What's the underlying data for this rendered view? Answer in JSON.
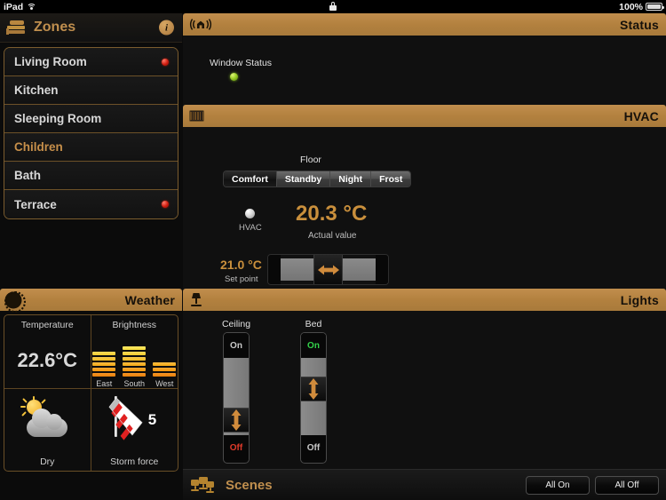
{
  "statusbar": {
    "device": "iPad",
    "wifi_icon": "wifi-icon",
    "lock_icon": "lock-icon",
    "battery_percent": "100%",
    "battery_icon": "battery-icon"
  },
  "sidebar": {
    "header": {
      "title": "Zones",
      "icon": "bed-icon",
      "info_label": "i"
    },
    "zones": [
      {
        "label": "Living Room",
        "selected": false,
        "alarm": true
      },
      {
        "label": "Kitchen",
        "selected": false,
        "alarm": false
      },
      {
        "label": "Sleeping Room",
        "selected": false,
        "alarm": false
      },
      {
        "label": "Children",
        "selected": true,
        "alarm": false
      },
      {
        "label": "Bath",
        "selected": false,
        "alarm": false
      },
      {
        "label": "Terrace",
        "selected": false,
        "alarm": true
      }
    ]
  },
  "weather": {
    "header": {
      "title": "Weather",
      "icon": "sun-icon"
    },
    "temperature": {
      "label": "Temperature",
      "value": "22.6°C"
    },
    "brightness": {
      "label": "Brightness",
      "directions": [
        {
          "name": "East",
          "level": 5
        },
        {
          "name": "South",
          "level": 6
        },
        {
          "name": "West",
          "level": 3
        }
      ],
      "max_level": 6
    },
    "condition": {
      "icon": "sun-cloud-icon",
      "label": "Dry"
    },
    "wind": {
      "icon": "windsock-icon",
      "value": "5",
      "label": "Storm force"
    }
  },
  "status_panel": {
    "header": {
      "title": "Status",
      "icon": "house-signal-icon"
    },
    "items": [
      {
        "label": "Window Status",
        "led": "green"
      }
    ]
  },
  "hvac": {
    "header": {
      "title": "HVAC",
      "icon": "radiator-icon"
    },
    "zone_label": "Floor",
    "modes": [
      {
        "label": "Comfort",
        "active": true
      },
      {
        "label": "Standby",
        "active": false
      },
      {
        "label": "Night",
        "active": false
      },
      {
        "label": "Frost",
        "active": false
      }
    ],
    "indicator": {
      "label": "HVAC",
      "state": "white"
    },
    "actual": {
      "value": "20.3 °C",
      "label": "Actual value"
    },
    "setpoint": {
      "value": "21.0 °C",
      "label": "Set point",
      "handle_icon": "horizontal-double-arrow-icon"
    }
  },
  "lights": {
    "header": {
      "title": "Lights",
      "icon": "lamp-icon"
    },
    "channels": [
      {
        "name": "Ceiling",
        "on_label": "On",
        "off_label": "Off",
        "state": "off",
        "on_color": "#c9c9c9",
        "off_color": "#e03a2a",
        "knob_position_pct": 68,
        "handle_icon": "vertical-double-arrow-icon"
      },
      {
        "name": "Bed",
        "on_label": "On",
        "off_label": "Off",
        "state": "on",
        "on_color": "#33d24a",
        "off_color": "#c9c9c9",
        "knob_position_pct": 33,
        "handle_icon": "vertical-double-arrow-icon"
      }
    ]
  },
  "scenes": {
    "title": "Scenes",
    "icon": "scenes-icon",
    "buttons": [
      {
        "label": "All On"
      },
      {
        "label": "All Off"
      }
    ]
  },
  "colors": {
    "header_gold": "#b3813f",
    "accent_orange": "#c98f3c",
    "panel_bg": "#101010",
    "led_red": "#d01d10",
    "led_green": "#9ccf27"
  }
}
